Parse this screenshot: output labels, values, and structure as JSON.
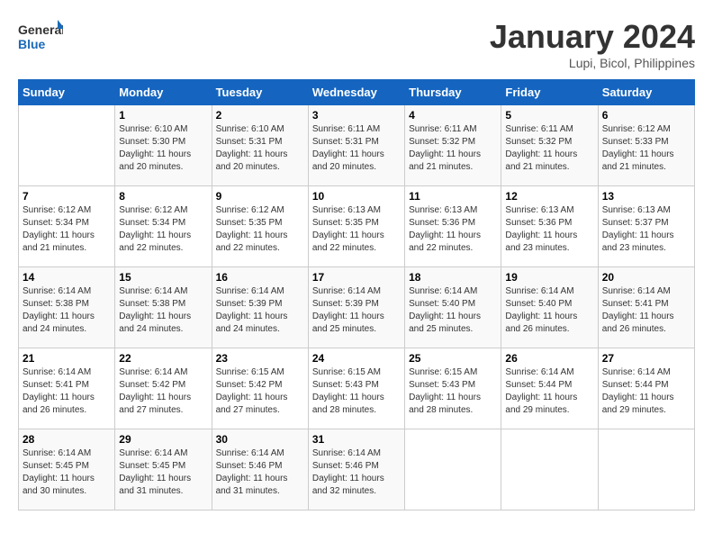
{
  "header": {
    "logo_line1": "General",
    "logo_line2": "Blue",
    "month_title": "January 2024",
    "subtitle": "Lupi, Bicol, Philippines"
  },
  "days_of_week": [
    "Sunday",
    "Monday",
    "Tuesday",
    "Wednesday",
    "Thursday",
    "Friday",
    "Saturday"
  ],
  "weeks": [
    [
      {
        "day": "",
        "sunrise": "",
        "sunset": "",
        "daylight": ""
      },
      {
        "day": "1",
        "sunrise": "6:10 AM",
        "sunset": "5:30 PM",
        "daylight": "11 hours and 20 minutes."
      },
      {
        "day": "2",
        "sunrise": "6:10 AM",
        "sunset": "5:31 PM",
        "daylight": "11 hours and 20 minutes."
      },
      {
        "day": "3",
        "sunrise": "6:11 AM",
        "sunset": "5:31 PM",
        "daylight": "11 hours and 20 minutes."
      },
      {
        "day": "4",
        "sunrise": "6:11 AM",
        "sunset": "5:32 PM",
        "daylight": "11 hours and 21 minutes."
      },
      {
        "day": "5",
        "sunrise": "6:11 AM",
        "sunset": "5:32 PM",
        "daylight": "11 hours and 21 minutes."
      },
      {
        "day": "6",
        "sunrise": "6:12 AM",
        "sunset": "5:33 PM",
        "daylight": "11 hours and 21 minutes."
      }
    ],
    [
      {
        "day": "7",
        "sunrise": "6:12 AM",
        "sunset": "5:34 PM",
        "daylight": "11 hours and 21 minutes."
      },
      {
        "day": "8",
        "sunrise": "6:12 AM",
        "sunset": "5:34 PM",
        "daylight": "11 hours and 22 minutes."
      },
      {
        "day": "9",
        "sunrise": "6:12 AM",
        "sunset": "5:35 PM",
        "daylight": "11 hours and 22 minutes."
      },
      {
        "day": "10",
        "sunrise": "6:13 AM",
        "sunset": "5:35 PM",
        "daylight": "11 hours and 22 minutes."
      },
      {
        "day": "11",
        "sunrise": "6:13 AM",
        "sunset": "5:36 PM",
        "daylight": "11 hours and 22 minutes."
      },
      {
        "day": "12",
        "sunrise": "6:13 AM",
        "sunset": "5:36 PM",
        "daylight": "11 hours and 23 minutes."
      },
      {
        "day": "13",
        "sunrise": "6:13 AM",
        "sunset": "5:37 PM",
        "daylight": "11 hours and 23 minutes."
      }
    ],
    [
      {
        "day": "14",
        "sunrise": "6:14 AM",
        "sunset": "5:38 PM",
        "daylight": "11 hours and 24 minutes."
      },
      {
        "day": "15",
        "sunrise": "6:14 AM",
        "sunset": "5:38 PM",
        "daylight": "11 hours and 24 minutes."
      },
      {
        "day": "16",
        "sunrise": "6:14 AM",
        "sunset": "5:39 PM",
        "daylight": "11 hours and 24 minutes."
      },
      {
        "day": "17",
        "sunrise": "6:14 AM",
        "sunset": "5:39 PM",
        "daylight": "11 hours and 25 minutes."
      },
      {
        "day": "18",
        "sunrise": "6:14 AM",
        "sunset": "5:40 PM",
        "daylight": "11 hours and 25 minutes."
      },
      {
        "day": "19",
        "sunrise": "6:14 AM",
        "sunset": "5:40 PM",
        "daylight": "11 hours and 26 minutes."
      },
      {
        "day": "20",
        "sunrise": "6:14 AM",
        "sunset": "5:41 PM",
        "daylight": "11 hours and 26 minutes."
      }
    ],
    [
      {
        "day": "21",
        "sunrise": "6:14 AM",
        "sunset": "5:41 PM",
        "daylight": "11 hours and 26 minutes."
      },
      {
        "day": "22",
        "sunrise": "6:14 AM",
        "sunset": "5:42 PM",
        "daylight": "11 hours and 27 minutes."
      },
      {
        "day": "23",
        "sunrise": "6:15 AM",
        "sunset": "5:42 PM",
        "daylight": "11 hours and 27 minutes."
      },
      {
        "day": "24",
        "sunrise": "6:15 AM",
        "sunset": "5:43 PM",
        "daylight": "11 hours and 28 minutes."
      },
      {
        "day": "25",
        "sunrise": "6:15 AM",
        "sunset": "5:43 PM",
        "daylight": "11 hours and 28 minutes."
      },
      {
        "day": "26",
        "sunrise": "6:14 AM",
        "sunset": "5:44 PM",
        "daylight": "11 hours and 29 minutes."
      },
      {
        "day": "27",
        "sunrise": "6:14 AM",
        "sunset": "5:44 PM",
        "daylight": "11 hours and 29 minutes."
      }
    ],
    [
      {
        "day": "28",
        "sunrise": "6:14 AM",
        "sunset": "5:45 PM",
        "daylight": "11 hours and 30 minutes."
      },
      {
        "day": "29",
        "sunrise": "6:14 AM",
        "sunset": "5:45 PM",
        "daylight": "11 hours and 31 minutes."
      },
      {
        "day": "30",
        "sunrise": "6:14 AM",
        "sunset": "5:46 PM",
        "daylight": "11 hours and 31 minutes."
      },
      {
        "day": "31",
        "sunrise": "6:14 AM",
        "sunset": "5:46 PM",
        "daylight": "11 hours and 32 minutes."
      },
      {
        "day": "",
        "sunrise": "",
        "sunset": "",
        "daylight": ""
      },
      {
        "day": "",
        "sunrise": "",
        "sunset": "",
        "daylight": ""
      },
      {
        "day": "",
        "sunrise": "",
        "sunset": "",
        "daylight": ""
      }
    ]
  ]
}
